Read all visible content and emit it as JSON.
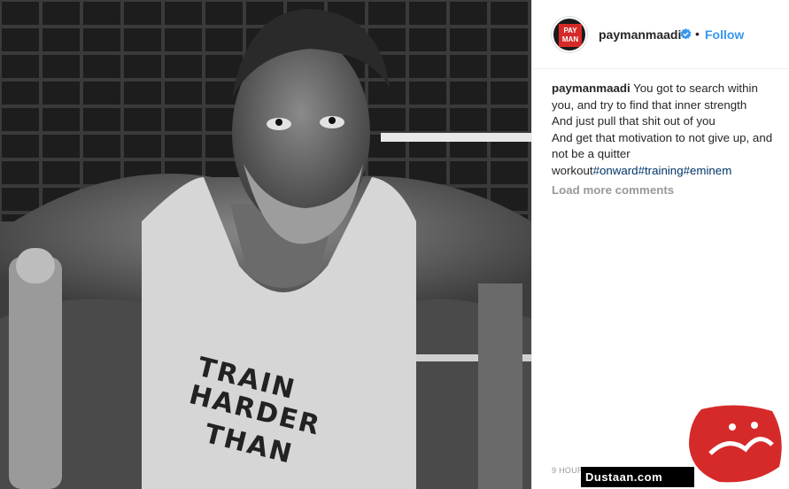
{
  "post": {
    "shirt_text_lines": [
      "TRAIN",
      "HARDER",
      "THAN"
    ]
  },
  "header": {
    "avatar_text_line1": "PAY",
    "avatar_text_line2": "MAN",
    "username": "paymanmaadi",
    "separator": "•",
    "follow_label": "Follow"
  },
  "caption": {
    "username": "paymanmaadi",
    "line1_text": " You got to search within",
    "line2": "you, and try to find that inner strength",
    "line3": "And just pull that shit out of you",
    "line4": "And get that motivation to not give up, and",
    "line5": "not be a quitter",
    "line6_prefix": "workout",
    "hashtags": [
      "#onward",
      "#training",
      "#eminem"
    ]
  },
  "load_more_label": "Load more comments",
  "timestamp": "9 HOURS AGO",
  "watermark": {
    "site": "Dustaan.com",
    "logo_text": "مجله دوستان"
  },
  "colors": {
    "accent": "#3897f0",
    "hashtag": "#003569",
    "muted": "#999999",
    "text": "#262626",
    "watermark_red": "#d62a2a"
  }
}
